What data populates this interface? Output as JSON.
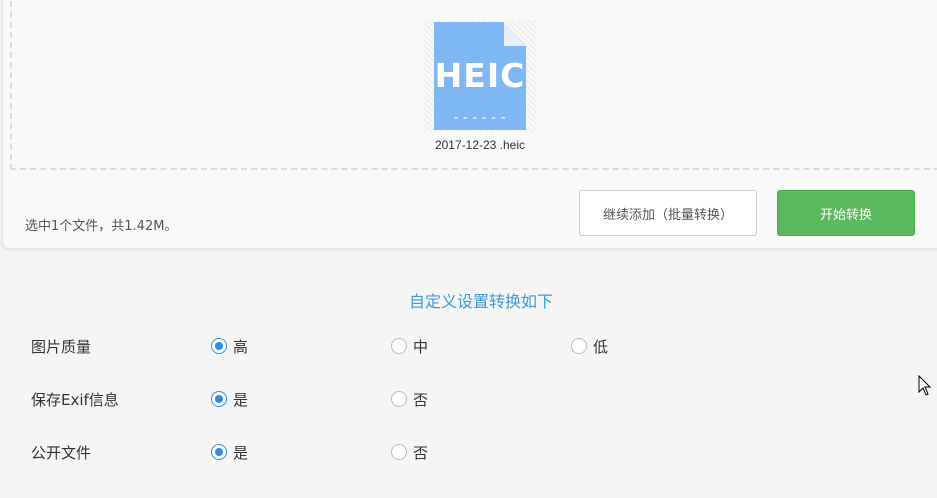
{
  "upload": {
    "file": {
      "extension_label": "HEIC",
      "name": "2017-12-23 .heic",
      "icon": "heic-file-icon"
    },
    "summary": "选中1个文件，共1.42M。",
    "continue_label": "继续添加（批量转换）",
    "start_label": "开始转换"
  },
  "settings": {
    "title": "自定义设置转换如下",
    "quality": {
      "label": "图片质量",
      "options": [
        "高",
        "中",
        "低"
      ],
      "selected": "高"
    },
    "exif": {
      "label": "保存Exif信息",
      "options": [
        "是",
        "否"
      ],
      "selected": "是"
    },
    "public": {
      "label": "公开文件",
      "options": [
        "是",
        "否"
      ],
      "selected": "是"
    }
  },
  "colors": {
    "accent": "#2e8de6",
    "title": "#3d9ad8",
    "start_button": "#5cb85c",
    "file_icon": "#7fb7f5"
  }
}
